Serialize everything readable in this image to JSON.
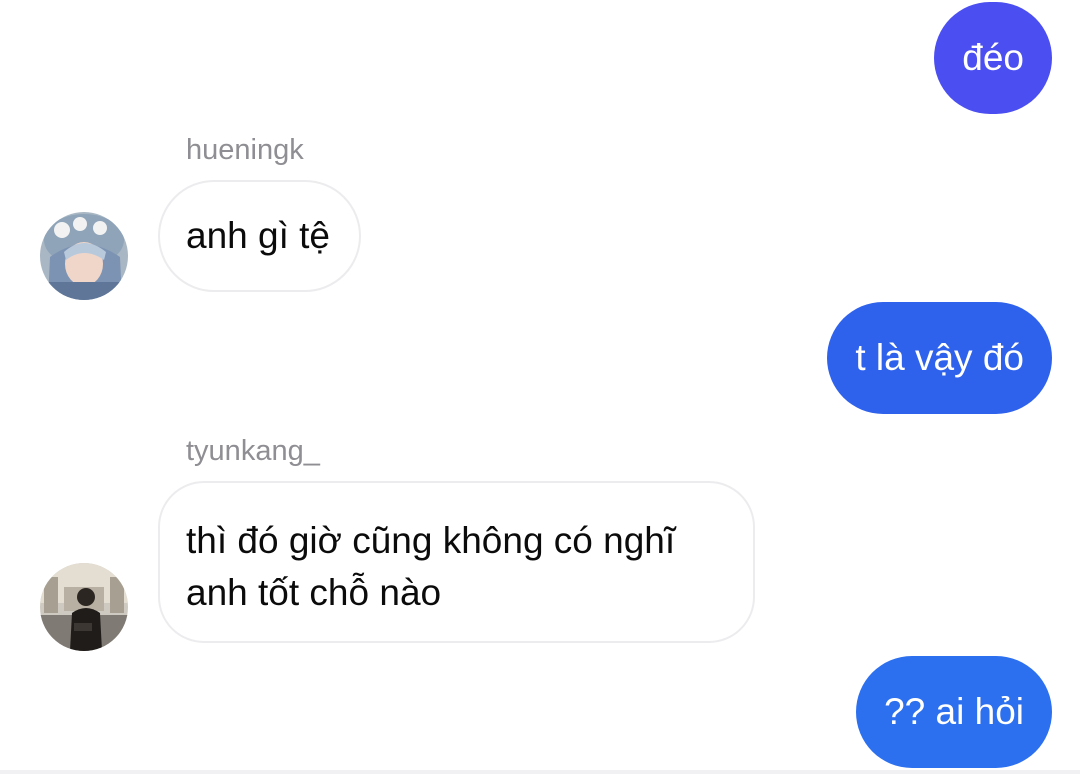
{
  "messages": [
    {
      "kind": "sent",
      "text": "đéo"
    },
    {
      "kind": "received",
      "username": "hueningk",
      "text": "anh gì tệ"
    },
    {
      "kind": "sent",
      "text": "t là vậy đó"
    },
    {
      "kind": "received",
      "username": "tyunkang_",
      "lines": [
        "thì đó giờ cũng không có nghĩ",
        "anh tốt chỗ nào"
      ]
    },
    {
      "kind": "sent",
      "text": "?? ai hỏi"
    }
  ],
  "colors": {
    "sent_bubble_1": "#4b4ef0",
    "sent_bubble_2": "#2f62ec",
    "sent_bubble_3": "#2c70ef",
    "received_border": "#ececee",
    "username_text": "#8e8e93"
  },
  "icons": {
    "avatar_1": "profile-photo-hueningk",
    "avatar_2": "profile-photo-tyunkang"
  }
}
